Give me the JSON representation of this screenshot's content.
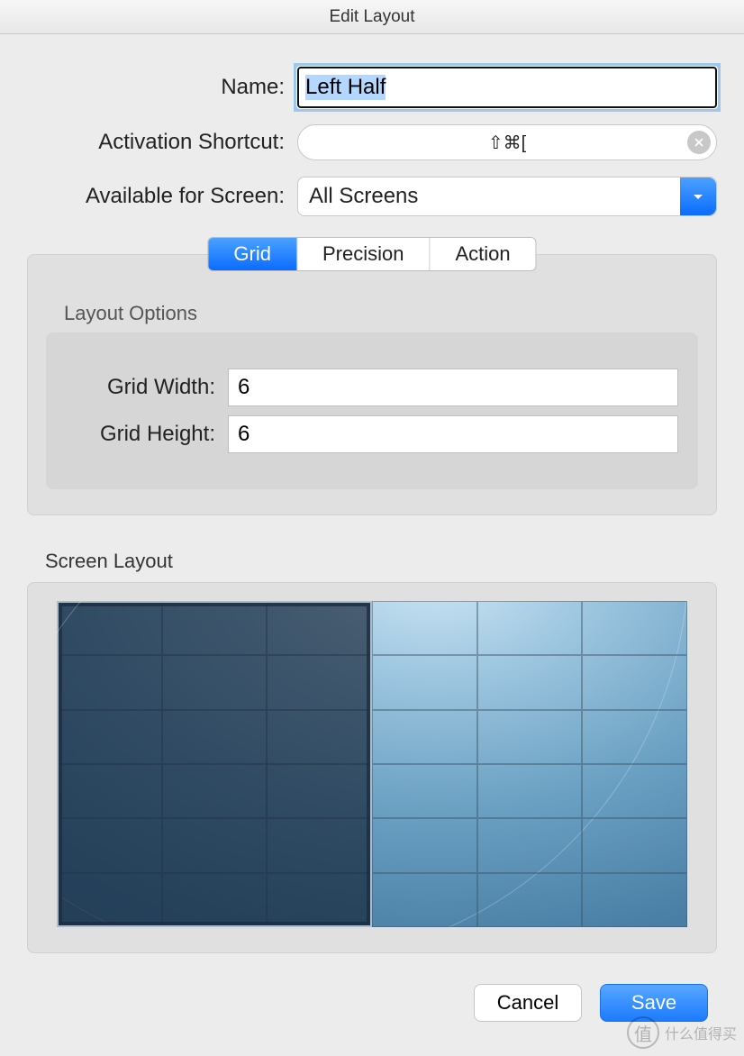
{
  "window": {
    "title": "Edit Layout"
  },
  "form": {
    "name_label": "Name:",
    "name_value": "Left Half",
    "shortcut_label": "Activation Shortcut:",
    "shortcut_value": "⇧⌘[",
    "screen_label": "Available for Screen:",
    "screen_value": "All Screens"
  },
  "tabs": {
    "items": [
      "Grid",
      "Precision",
      "Action"
    ],
    "active_index": 0
  },
  "layout_options": {
    "heading": "Layout Options",
    "width_label": "Grid Width:",
    "width_value": "6",
    "height_label": "Grid Height:",
    "height_value": "6"
  },
  "screen_layout": {
    "heading": "Screen Layout",
    "grid_cols": 6,
    "grid_rows": 6,
    "selection": {
      "col_start": 1,
      "col_span": 3,
      "row_start": 1,
      "row_span": 6
    }
  },
  "footer": {
    "cancel": "Cancel",
    "save": "Save"
  },
  "watermark": {
    "badge": "值",
    "text": "什么值得买"
  }
}
